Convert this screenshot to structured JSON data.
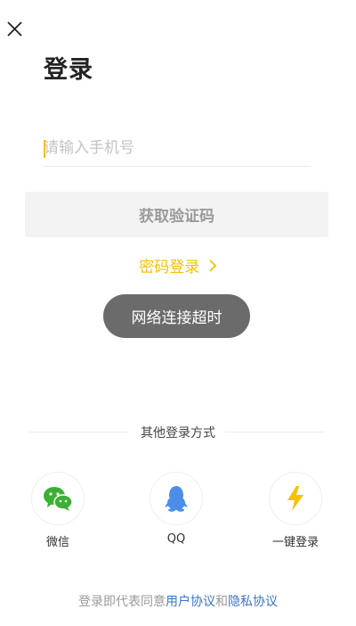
{
  "header": {
    "title": "登录",
    "close_icon": "close-icon"
  },
  "phone": {
    "placeholder": "请输入手机号",
    "value": ""
  },
  "get_code_button": {
    "label": "获取验证码"
  },
  "password_login": {
    "label": "密码登录",
    "icon": "chevron-right-icon"
  },
  "toast": {
    "message": "网络连接超时"
  },
  "other_login": {
    "label": "其他登录方式",
    "options": [
      {
        "label": "微信",
        "icon": "wechat-icon",
        "color": "#3cb034"
      },
      {
        "label": "QQ",
        "icon": "qq-penguin-icon",
        "color": "#4a8ee8"
      },
      {
        "label": "一键登录",
        "icon": "lightning-icon",
        "color": "#f6c100"
      }
    ]
  },
  "agreement": {
    "prefix": "登录即代表同意",
    "user_agreement": "用户协议",
    "and": "和",
    "privacy_policy": "隐私协议"
  },
  "colors": {
    "accent": "#f6c100",
    "link": "#3b74c8",
    "toast_bg": "#6b6b6b"
  }
}
